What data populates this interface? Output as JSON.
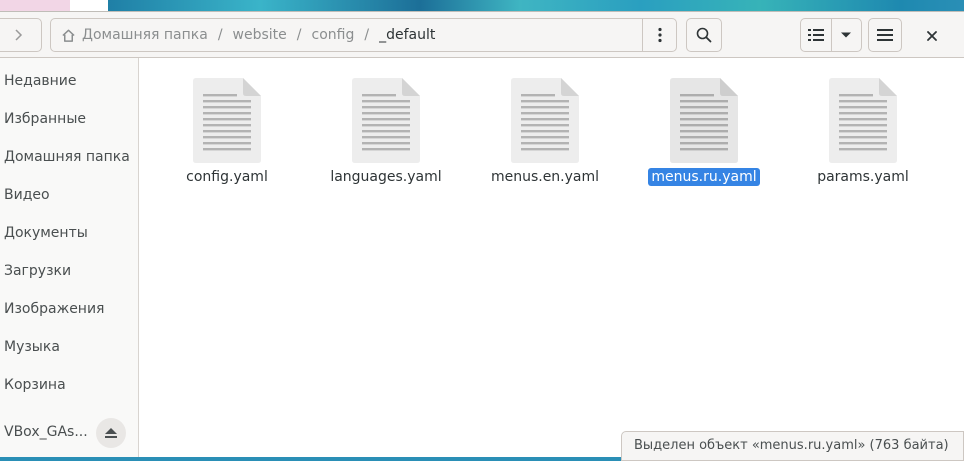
{
  "window": {
    "path": {
      "crumbs": [
        "Домашняя папка",
        "website",
        "config",
        "_default"
      ],
      "separator": "/"
    }
  },
  "sidebar": {
    "items": [
      {
        "label": "Недавние"
      },
      {
        "label": "Избранные"
      },
      {
        "label": "Домашняя папка"
      },
      {
        "label": "Видео"
      },
      {
        "label": "Документы"
      },
      {
        "label": "Загрузки"
      },
      {
        "label": "Изображения"
      },
      {
        "label": "Музыка"
      },
      {
        "label": "Корзина"
      },
      {
        "label": "VBox_GAs..."
      }
    ]
  },
  "files": [
    {
      "name": "config.yaml",
      "selected": false
    },
    {
      "name": "languages.yaml",
      "selected": false
    },
    {
      "name": "menus.en.yaml",
      "selected": false
    },
    {
      "name": "menus.ru.yaml",
      "selected": true
    },
    {
      "name": "params.yaml",
      "selected": false
    }
  ],
  "status": {
    "text": "Выделен объект «menus.ru.yaml» (763 байта)"
  },
  "icons": {
    "forward": "chevron-right-icon",
    "home": "home-icon",
    "path_menu": "vertical-dots-icon",
    "search": "search-icon",
    "view": "list-view-icon",
    "view_options": "chevron-down-icon",
    "menu": "hamburger-icon",
    "close": "close-icon",
    "eject": "eject-icon",
    "file": "text-file-icon"
  },
  "colors": {
    "selection": "#3584e4",
    "headerbar": "#f6f5f4",
    "sidebar": "#f9f9f8"
  }
}
